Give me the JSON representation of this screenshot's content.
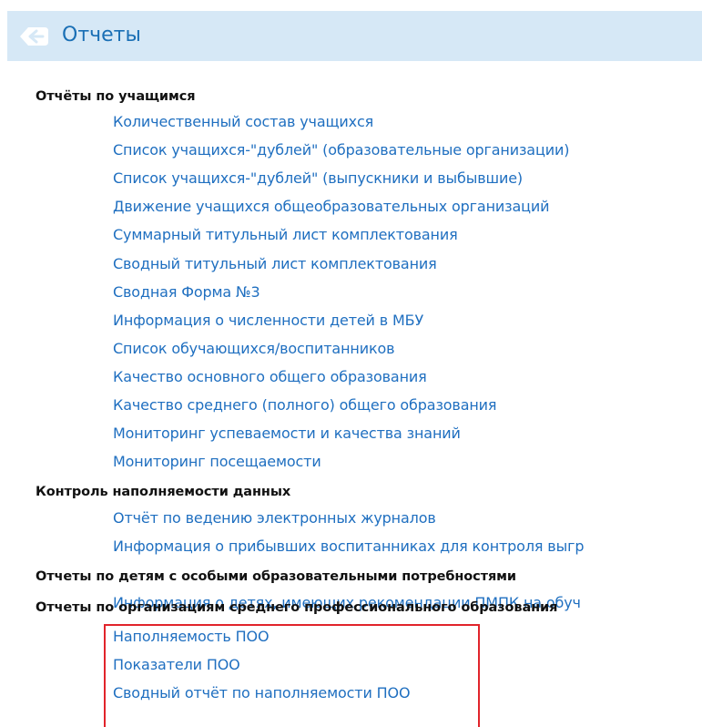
{
  "header": {
    "title": "Отчеты",
    "icon": "back-arrow-icon",
    "background_color": "#d6e8f6",
    "title_color": "#1a6fb5"
  },
  "sections": [
    {
      "title": "Отчёты по учащимся",
      "links": [
        "Количественный состав учащихся",
        "Список учащихся-\"дублей\" (образовательные организации)",
        "Список учащихся-\"дублей\" (выпускники и выбывшие)",
        "Движение учащихся общеобразовательных организаций",
        "Суммарный титульный лист комплектования",
        "Сводный титульный лист комплектования",
        "Сводная Форма №3",
        "Информация о численности детей в МБУ",
        "Список обучающихся/воспитанников",
        "Качество основного общего образования",
        "Качество среднего (полного) общего образования",
        "Мониторинг успеваемости и качества знаний",
        "Мониторинг посещаемости"
      ]
    },
    {
      "title": "Контроль наполняемости данных",
      "links": [
        "Отчёт по ведению электронных журналов",
        "Информация о прибывших воспитанниках для контроля выгр"
      ]
    },
    {
      "title": "Отчеты по детям с особыми образовательными потребностями",
      "links": [
        "Информация о детях, имеющих рекомендации ПМПК на обуч"
      ]
    },
    {
      "title": "Отчеты по организациям среднего профессионального образования",
      "links": [
        "Наполняемость ПОО",
        "Показатели ПОО",
        "Сводный отчёт по наполняемости ПОО"
      ]
    }
  ],
  "highlight": {
    "color": "#e1242b"
  },
  "colors": {
    "link": "#1f6fc0",
    "section_title": "#111111"
  }
}
